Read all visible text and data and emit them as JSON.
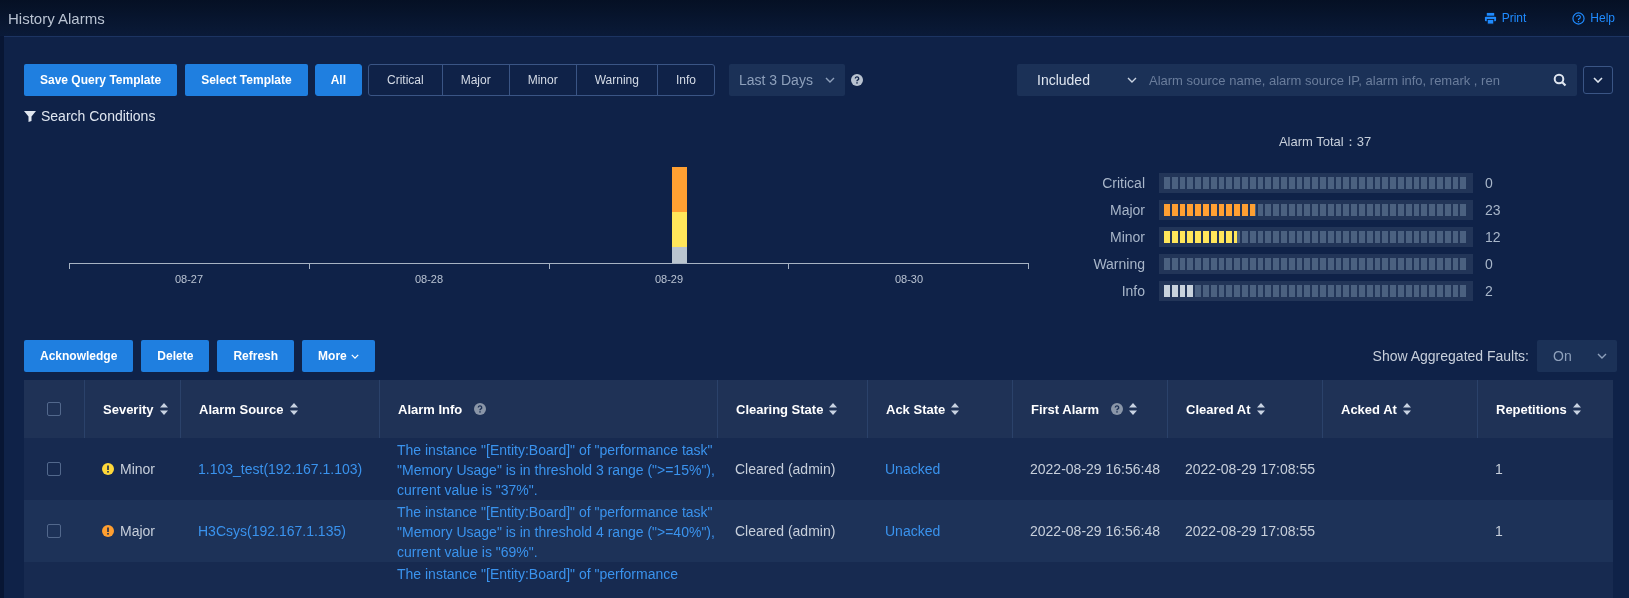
{
  "header": {
    "title": "History Alarms",
    "links": [
      {
        "label": "Print"
      },
      {
        "label": "Help"
      }
    ]
  },
  "toolbar": {
    "buttons": [
      "Save Query Template",
      "Select Template"
    ],
    "severity_filter": [
      {
        "label": "All",
        "selected": true
      },
      {
        "label": "Critical",
        "selected": false
      },
      {
        "label": "Major",
        "selected": false
      },
      {
        "label": "Minor",
        "selected": false
      },
      {
        "label": "Warning",
        "selected": false
      },
      {
        "label": "Info",
        "selected": false
      }
    ],
    "time_range": "Last 3 Days",
    "match_mode": "Included",
    "search": {
      "placeholder": "Alarm source name, alarm source IP, alarm info, remark , ren"
    }
  },
  "search_conditions": "Search Conditions",
  "timeline": {
    "labels": [
      "08-27",
      "08-28",
      "08-29",
      "08-30"
    ]
  },
  "summary": {
    "title": "Alarm Total：37",
    "levels": [
      {
        "label": "Critical",
        "count": "0"
      },
      {
        "label": "Major",
        "count": "23",
        "level": 0.3,
        "color": "#ffa032"
      },
      {
        "label": "Minor",
        "count": "12",
        "level": 0.24,
        "color": "#ffe65a"
      },
      {
        "label": "Warning",
        "count": "0"
      },
      {
        "label": "Info",
        "count": "2",
        "level": 0.1,
        "color": "#c8d2dc"
      }
    ]
  },
  "actions": {
    "buttons": [
      "Acknowledge",
      "Delete",
      "Refresh"
    ],
    "more": "More",
    "aggregated_label": "Show Aggregated Faults:",
    "aggregated_value": "On"
  },
  "table": {
    "select_all_checked": false,
    "columns": [
      {
        "label": "Severity",
        "sortable": true,
        "help": false
      },
      {
        "label": "Alarm Source",
        "sortable": true,
        "help": false
      },
      {
        "label": "Alarm Info",
        "sortable": false,
        "help": true
      },
      {
        "label": "Clearing State",
        "sortable": true,
        "help": false
      },
      {
        "label": "Ack State",
        "sortable": true,
        "help": false
      },
      {
        "label": "First Alarm",
        "sortable": true,
        "help": true
      },
      {
        "label": "Cleared At",
        "sortable": true,
        "help": false
      },
      {
        "label": "Acked At",
        "sortable": true,
        "help": false
      },
      {
        "label": "Repetitions",
        "sortable": true,
        "help": false
      }
    ],
    "rows": [
      {
        "checked": false,
        "severity": "Minor",
        "color": "#ffd83a",
        "source": "1.103_test(192.167.1.103)",
        "info": "The instance \"[Entity:Board]\" of \"performance task\" \"Memory Usage\" is in threshold 3 range (\">=15%\"), current value is \"37%\".",
        "clearing": "Cleared (admin)",
        "ack": "Unacked",
        "first": "2022-08-29 16:56:48",
        "cleared": "2022-08-29 17:08:55",
        "repetitions": "1"
      },
      {
        "checked": false,
        "severity": "Major",
        "color": "#ff9f30",
        "source": "H3Csys(192.167.1.135)",
        "info": "The instance \"[Entity:Board]\" of \"performance task\" \"Memory Usage\" is in threshold 4 range (\">=40%\"), current value is \"69%\".",
        "clearing": "Cleared (admin)",
        "ack": "Unacked",
        "first": "2022-08-29 16:56:48",
        "cleared": "2022-08-29 17:08:55",
        "repetitions": "1"
      },
      {
        "info": "The instance \"[Entity:Board]\" of \"performance"
      }
    ]
  }
}
